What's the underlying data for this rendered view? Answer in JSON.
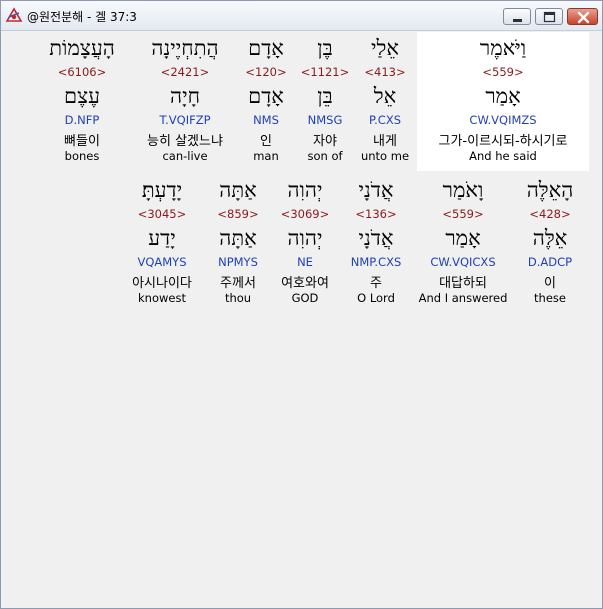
{
  "window": {
    "title": "@원전분해 - 겔 37:3"
  },
  "rows": [
    [
      {
        "hebrew": "וַיֹּאמֶר",
        "strong": "<559>",
        "lemma": "אָמַר",
        "morph": "CW.VQIMZS",
        "korean": "그가-이르시되-하시기로",
        "english": "And he said"
      },
      {
        "hebrew": "אֵלַי",
        "strong": "<413>",
        "lemma": "אֵל",
        "morph": "P.CXS",
        "korean": "내게",
        "english": "unto me"
      },
      {
        "hebrew": "בֶּן",
        "strong": "<1121>",
        "lemma": "בֵּן",
        "morph": "NMSG",
        "korean": "자야",
        "english": "son of"
      },
      {
        "hebrew": "אָדָם",
        "strong": "<120>",
        "lemma": "אָדָם",
        "morph": "NMS",
        "korean": "인",
        "english": "man"
      },
      {
        "hebrew": "הֲתִחְיֶינָה",
        "strong": "<2421>",
        "lemma": "חָיָה",
        "morph": "T.VQIFZP",
        "korean": "능히 살겠느냐",
        "english": "can-live"
      },
      {
        "hebrew": "הָעֲצָמוֹת",
        "strong": "<6106>",
        "lemma": "עֶצֶם",
        "morph": "D.NFP",
        "korean": "뼈들이",
        "english": "bones"
      }
    ],
    [
      {
        "hebrew": "הָאֵלֶּה",
        "strong": "<428>",
        "lemma": "אֵלֶּה",
        "morph": "D.ADCP",
        "korean": "이",
        "english": "these"
      },
      {
        "hebrew": "וָאֹמַר",
        "strong": "<559>",
        "lemma": "אָמַר",
        "morph": "CW.VQICXS",
        "korean": "대답하되",
        "english": "And I answered"
      },
      {
        "hebrew": "אֲדֹנָי",
        "strong": "<136>",
        "lemma": "אֲדֹנָי",
        "morph": "NMP.CXS",
        "korean": "주",
        "english": "O Lord"
      },
      {
        "hebrew": "יְהוִה",
        "strong": "<3069>",
        "lemma": "יְהוִה",
        "morph": "NE",
        "korean": "여호와여",
        "english": "GOD"
      },
      {
        "hebrew": "אַתָּה",
        "strong": "<859>",
        "lemma": "אַתָּה",
        "morph": "NPMYS",
        "korean": "주께서",
        "english": "thou"
      },
      {
        "hebrew": "יָדָעְתָּ׃",
        "strong": "<3045>",
        "lemma": "יָדַע",
        "morph": "VQAMYS",
        "korean": "아시나이다",
        "english": "knowest"
      }
    ]
  ]
}
